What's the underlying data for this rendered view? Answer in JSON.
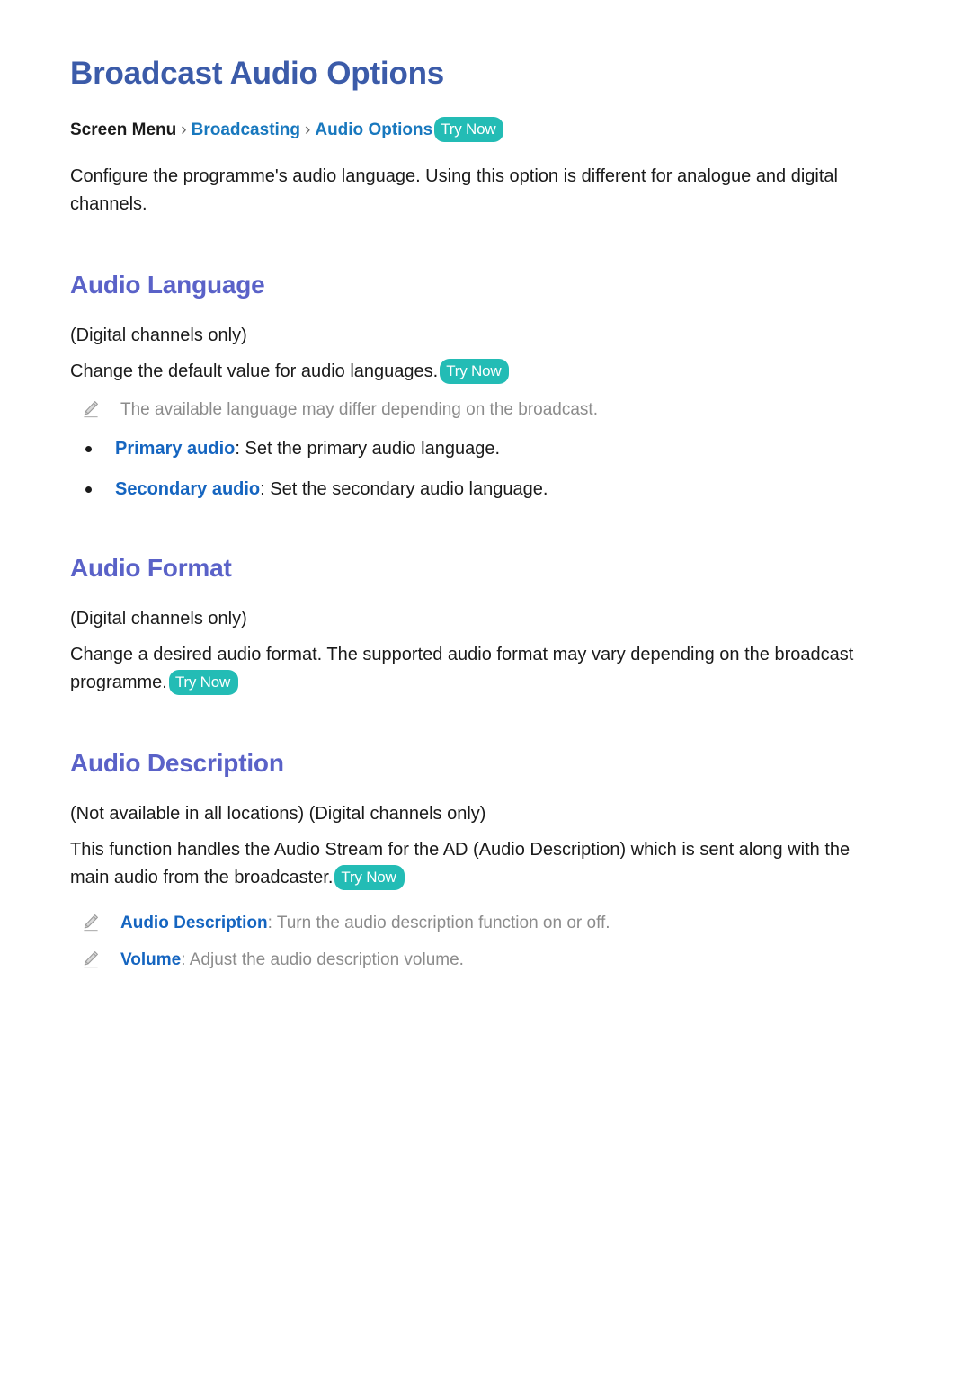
{
  "colors": {
    "title_blue": "#3b5ba9",
    "section_blue": "#5a62c8",
    "link_blue": "#1878be",
    "label_blue": "#1565c0",
    "badge_teal": "#23bcb5",
    "note_gray": "#8c8c8c",
    "body_black": "#1a1a1a",
    "page_background": "#ffffff"
  },
  "page": {
    "title": "Broadcast Audio Options"
  },
  "breadcrumb": {
    "root": "Screen Menu",
    "separator": "›",
    "link1": "Broadcasting",
    "link2": "Audio Options",
    "badge": "Try Now"
  },
  "intro": {
    "text": "Configure the programme's audio language. Using this option is different for analogue and digital channels."
  },
  "sections": [
    {
      "heading": "Audio Language",
      "availability": "(Digital channels only)",
      "description": "Change the default value for audio languages.",
      "badge": "Try Now",
      "note": "The available language may differ depending on the broadcast.",
      "bullets": [
        {
          "label": "Primary audio",
          "text": ": Set the primary audio language."
        },
        {
          "label": "Secondary audio",
          "text": ": Set the secondary audio language."
        }
      ]
    },
    {
      "heading": "Audio Format",
      "availability": "(Digital channels only)",
      "description": "Change a desired audio format. The supported audio format may vary depending on the broadcast programme.",
      "badge": "Try Now"
    },
    {
      "heading": "Audio Description",
      "availability": "(Not available in all locations) (Digital channels only)",
      "description": "This function handles the Audio Stream for the AD (Audio Description) which is sent along with the main audio from the broadcaster.",
      "badge": "Try Now",
      "notes": [
        {
          "label": "Audio Description",
          "text": ": Turn the audio description function on or off."
        },
        {
          "label": "Volume",
          "text": ": Adjust the audio description volume."
        }
      ]
    }
  ],
  "icons": {
    "pencil": "pencil-icon",
    "bullet": "bullet-dot-icon"
  }
}
